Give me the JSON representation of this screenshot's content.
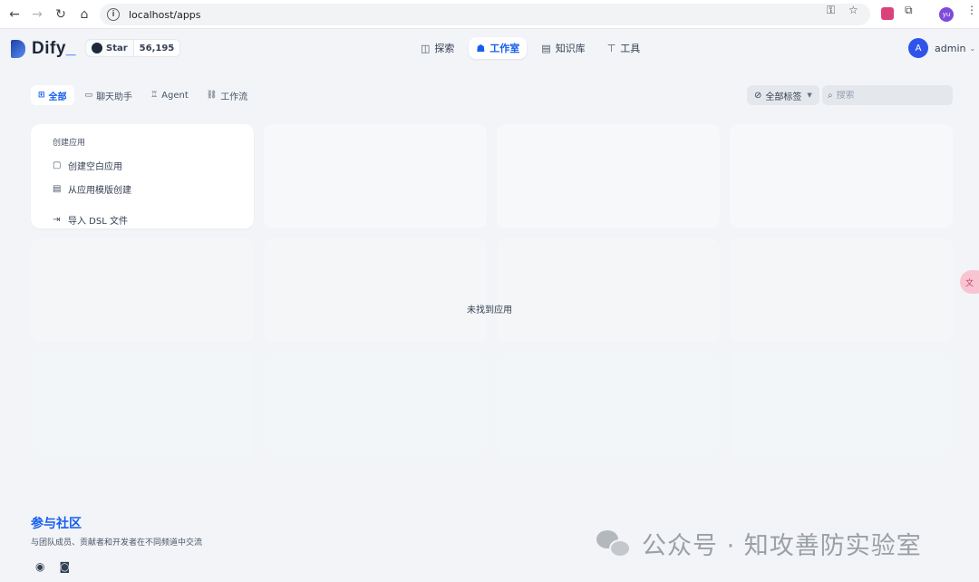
{
  "browser": {
    "url": "localhost/apps",
    "profile_initials": "yu"
  },
  "header": {
    "brand": "Dify",
    "brand_suffix": "_",
    "github_star_label": "Star",
    "github_star_count": "56,195",
    "nav": [
      {
        "label": "探索",
        "icon": "compass-icon"
      },
      {
        "label": "工作室",
        "icon": "robot-icon",
        "active": true
      },
      {
        "label": "知识库",
        "icon": "book-icon"
      },
      {
        "label": "工具",
        "icon": "hammer-icon"
      }
    ],
    "account": {
      "initial": "A",
      "name": "admin"
    }
  },
  "filters": {
    "tabs": [
      {
        "label": "全部",
        "icon": "grid-icon",
        "active": true
      },
      {
        "label": "聊天助手",
        "icon": "chat-icon"
      },
      {
        "label": "Agent",
        "icon": "agent-icon"
      },
      {
        "label": "工作流",
        "icon": "workflow-icon"
      }
    ],
    "tag_filter_label": "全部标签",
    "search_placeholder": "搜索"
  },
  "create_card": {
    "header": "创建应用",
    "actions": [
      {
        "label": "创建空白应用",
        "icon": "new-file-icon"
      },
      {
        "label": "从应用模版创建",
        "icon": "template-icon"
      },
      {
        "label": "导入 DSL 文件",
        "icon": "import-icon"
      }
    ]
  },
  "empty_message": "未找到应用",
  "community": {
    "title": "参与社区",
    "description": "与团队成员、贡献者和开发者在不同频道中交流"
  },
  "watermark": "公众号 · 知攻善防实验室",
  "colors": {
    "accent": "#155eef",
    "background": "#f2f4f7"
  }
}
